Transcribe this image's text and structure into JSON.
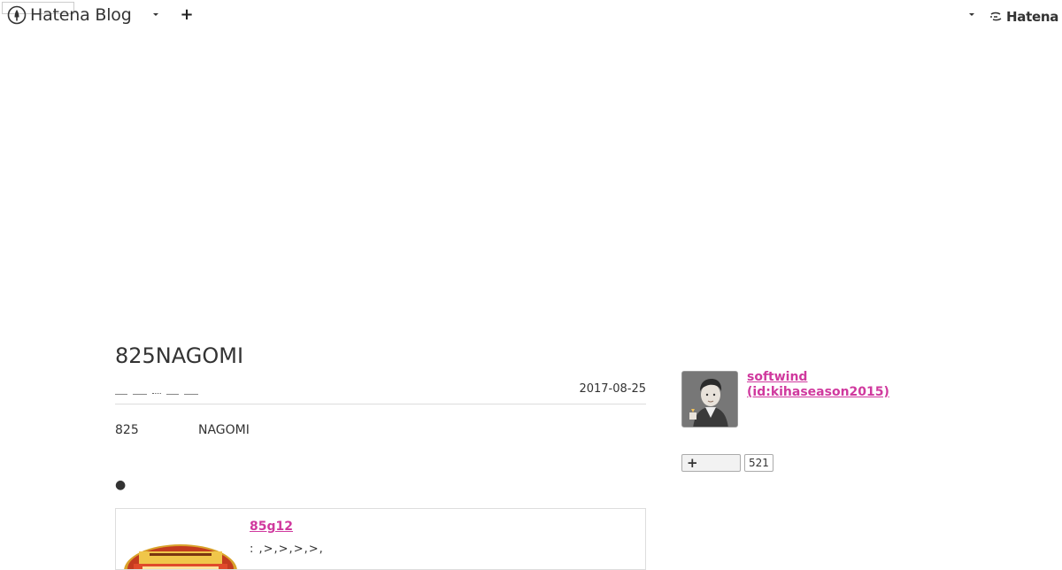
{
  "header": {
    "logo_text": "Hatena Blog",
    "hatena_text": "Hatena",
    "icons": {
      "menu": "chevron-down-icon",
      "add": "plus-icon"
    }
  },
  "entry": {
    "title": "825NAGOMI",
    "date": "2017-08-25",
    "body_number": "825",
    "body_text": "NAGOMI",
    "bullet": "●"
  },
  "card": {
    "link_text": "85g12",
    "subtext": ":  ,>,>,>,>,"
  },
  "profile": {
    "name_line1": "softwind",
    "name_line2": "(id:kihaseason2015)",
    "follower_count": "521"
  },
  "colors": {
    "link": "#d0399e",
    "text": "#333333",
    "border": "#dddddd"
  }
}
